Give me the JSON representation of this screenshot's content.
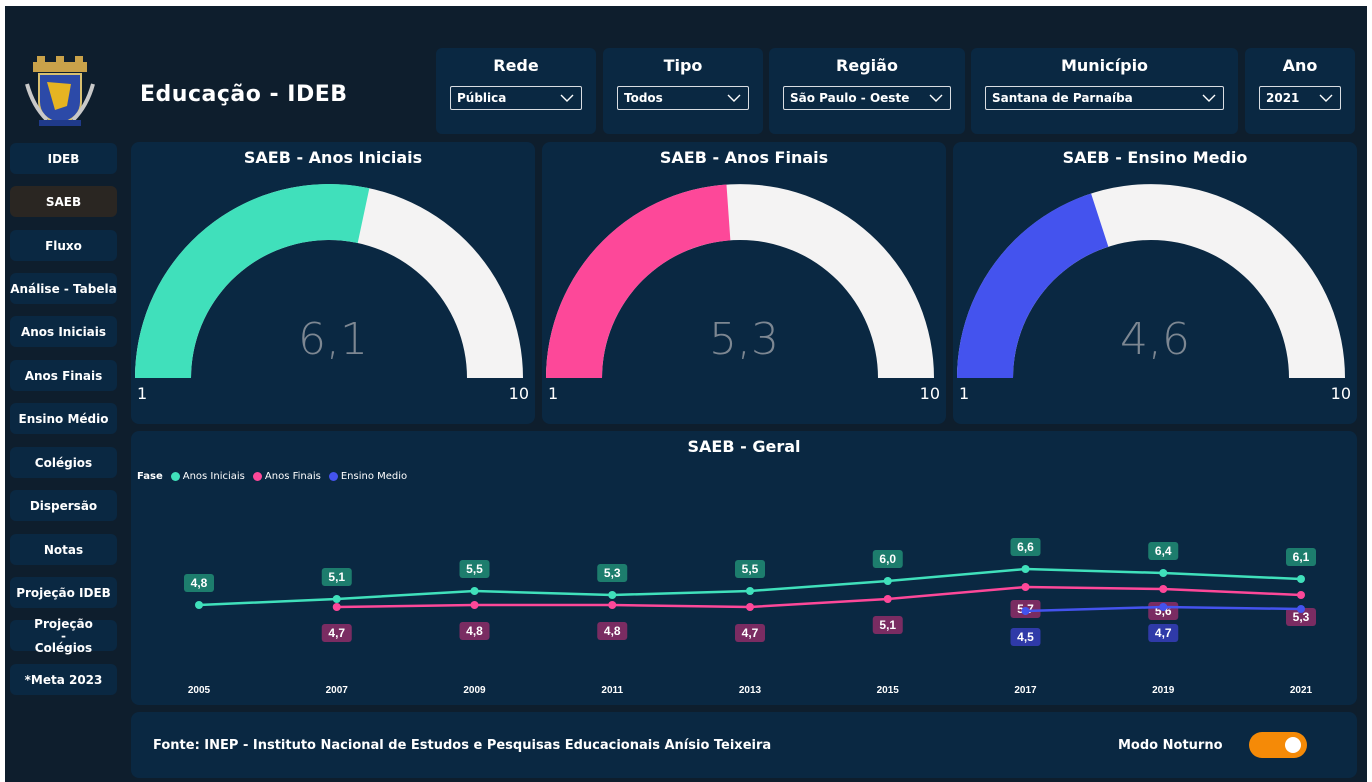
{
  "header": {
    "title": "Educação - IDEB",
    "logo_icon": "coat-of-arms-icon"
  },
  "filters": [
    {
      "label": "Rede",
      "value": "Pública"
    },
    {
      "label": "Tipo",
      "value": "Todos"
    },
    {
      "label": "Região",
      "value": "São Paulo - Oeste"
    },
    {
      "label": "Município",
      "value": "Santana de Parnaíba"
    },
    {
      "label": "Ano",
      "value": "2021"
    }
  ],
  "nav": {
    "active": "SAEB",
    "items": [
      "IDEB",
      "SAEB",
      "Fluxo",
      "Análise - Tabela",
      "Anos Iniciais",
      "Anos Finais",
      "Ensino Médio",
      "Colégios",
      "Dispersão",
      "Notas",
      "Projeção IDEB",
      "Projeção - Colégios",
      "*Meta 2023"
    ]
  },
  "gauges": [
    {
      "title": "SAEB - Anos Iniciais",
      "value": 6.1,
      "value_label": "6,1",
      "min": 1,
      "max": 10,
      "min_label": "1",
      "max_label": "10",
      "color": "#40e0bb"
    },
    {
      "title": "SAEB - Anos Finais",
      "value": 5.3,
      "value_label": "5,3",
      "min": 1,
      "max": 10,
      "min_label": "1",
      "max_label": "10",
      "color": "#fd4899"
    },
    {
      "title": "SAEB - Ensino Medio",
      "value": 4.6,
      "value_label": "4,6",
      "min": 1,
      "max": 10,
      "min_label": "1",
      "max_label": "10",
      "color": "#4453ee"
    }
  ],
  "chart_data": {
    "type": "line",
    "title": "SAEB - Geral",
    "legend_title": "Fase",
    "legend_position": "top-left",
    "x": [
      "2005",
      "2007",
      "2009",
      "2011",
      "2013",
      "2015",
      "2017",
      "2019",
      "2021"
    ],
    "ylim": [
      4,
      7
    ],
    "grid": false,
    "series": [
      {
        "name": "Anos Iniciais",
        "color": "#40e0bb",
        "label_bg": "#1d7d6d",
        "values": [
          4.8,
          5.1,
          5.5,
          5.3,
          5.5,
          6.0,
          6.6,
          6.4,
          6.1
        ],
        "labels": [
          "4,8",
          "5,1",
          "5,5",
          "5,3",
          "5,5",
          "6,0",
          "6,6",
          "6,4",
          "6,1"
        ]
      },
      {
        "name": "Anos Finais",
        "color": "#fd4899",
        "label_bg": "#7a2c62",
        "values": [
          null,
          4.7,
          4.8,
          4.8,
          4.7,
          5.1,
          5.7,
          5.6,
          5.3
        ],
        "labels": [
          "",
          "4,7",
          "4,8",
          "4,8",
          "4,7",
          "5,1",
          "5,7",
          "5,6",
          "5,3"
        ]
      },
      {
        "name": "Ensino Medio",
        "color": "#4453ee",
        "label_bg": "#2f3aa8",
        "values": [
          null,
          null,
          null,
          null,
          null,
          null,
          4.5,
          4.7,
          4.6
        ],
        "labels": [
          "",
          "",
          "",
          "",
          "",
          "",
          "4,5",
          "4,7",
          ""
        ]
      }
    ]
  },
  "footer": {
    "source": "Fonte: INEP - Instituto Nacional de Estudos e Pesquisas Educacionais Anísio Teixeira",
    "toggle_label": "Modo Noturno",
    "toggle_on": true,
    "toggle_color": "#f58a07"
  }
}
